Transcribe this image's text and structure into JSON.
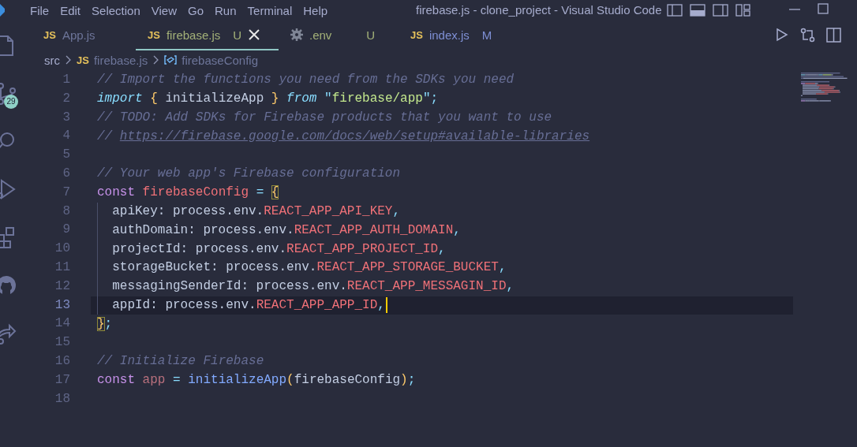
{
  "menu": [
    {
      "label": "File"
    },
    {
      "label": "Edit"
    },
    {
      "label": "Selection"
    },
    {
      "label": "View"
    },
    {
      "label": "Go"
    },
    {
      "label": "Run"
    },
    {
      "label": "Terminal"
    },
    {
      "label": "Help"
    }
  ],
  "window": {
    "title": "firebase.js - clone_project - Visual Studio Code"
  },
  "activity_bar": {
    "source_control_badge": "29"
  },
  "tabs": [
    {
      "kind": "js",
      "icon_text": "JS",
      "label": "App.js",
      "color": "#6d7599",
      "selected": false
    },
    {
      "kind": "js",
      "icon_text": "JS",
      "label": "firebase.js",
      "color": "#a3b178",
      "badge": "U",
      "selected": true
    },
    {
      "kind": "settings",
      "label": ".env",
      "color": "#a3b178",
      "badge": "U",
      "selected": false
    },
    {
      "kind": "js",
      "icon_text": "JS",
      "label": "index.js",
      "color": "#7e8fd4",
      "badge": "M",
      "selected": false
    }
  ],
  "breadcrumb": [
    {
      "kind": "folder",
      "label": "src"
    },
    {
      "kind": "js",
      "icon_text": "JS",
      "label": "firebase.js"
    },
    {
      "kind": "symbol",
      "label": "firebaseConfig"
    }
  ],
  "lines": [
    {
      "number": "1",
      "current": false,
      "cursor": false,
      "tokens": [
        {
          "kind": "comment",
          "text": "// Import the functions you need from the SDKs you need"
        }
      ]
    },
    {
      "number": "2",
      "current": false,
      "cursor": false,
      "tokens": [
        {
          "kind": "keyword",
          "text": "import"
        },
        {
          "kind": "brace",
          "text": " {"
        },
        {
          "kind": "plain",
          "text": " initializeApp "
        },
        {
          "kind": "brace",
          "text": "} "
        },
        {
          "kind": "keyword",
          "text": "from "
        },
        {
          "kind": "punct",
          "text": "\""
        },
        {
          "kind": "string",
          "text": "firebase/app"
        },
        {
          "kind": "punct",
          "text": "\";"
        }
      ]
    },
    {
      "number": "3",
      "current": false,
      "cursor": false,
      "tokens": [
        {
          "kind": "comment",
          "text": "// TODO: Add SDKs for Firebase products that you want to use"
        }
      ]
    },
    {
      "number": "4",
      "current": false,
      "cursor": false,
      "tokens": [
        {
          "kind": "comment",
          "text": "// "
        },
        {
          "kind": "link",
          "text": "https://firebase.google.com/docs/web/setup#available-libraries"
        }
      ]
    },
    {
      "number": "5",
      "current": false,
      "cursor": false
    },
    {
      "number": "6",
      "current": false,
      "cursor": false,
      "tokens": [
        {
          "kind": "comment",
          "text": "// Your web app's Firebase configuration"
        }
      ]
    },
    {
      "number": "7",
      "current": false,
      "cursor": false,
      "tokens": [
        {
          "kind": "storage",
          "text": "const "
        },
        {
          "kind": "definition",
          "text": "firebaseConfig"
        },
        {
          "kind": "punct",
          "text": " = "
        },
        {
          "kind": "bracket_match",
          "text": "{"
        }
      ]
    },
    {
      "number": "8",
      "current": false,
      "cursor": false,
      "indented": true,
      "tokens": [
        {
          "kind": "plain",
          "text": "apiKey: process.env."
        },
        {
          "kind": "env",
          "text": "REACT_APP_API_KEY"
        },
        {
          "kind": "punct",
          "text": ","
        }
      ]
    },
    {
      "number": "9",
      "current": false,
      "cursor": false,
      "indented": true,
      "tokens": [
        {
          "kind": "plain",
          "text": "authDomain: process.env."
        },
        {
          "kind": "env",
          "text": "REACT_APP_AUTH_DOMAIN"
        },
        {
          "kind": "punct",
          "text": ","
        }
      ]
    },
    {
      "number": "10",
      "current": false,
      "cursor": false,
      "indented": true,
      "tokens": [
        {
          "kind": "plain",
          "text": "projectId: process.env."
        },
        {
          "kind": "env",
          "text": "REACT_APP_PROJECT_ID"
        },
        {
          "kind": "punct",
          "text": ","
        }
      ]
    },
    {
      "number": "11",
      "current": false,
      "cursor": false,
      "indented": true,
      "tokens": [
        {
          "kind": "plain",
          "text": "storageBucket: process.env."
        },
        {
          "kind": "env",
          "text": "REACT_APP_STORAGE_BUCKET"
        },
        {
          "kind": "punct",
          "text": ","
        }
      ]
    },
    {
      "number": "12",
      "current": false,
      "cursor": false,
      "indented": true,
      "tokens": [
        {
          "kind": "plain",
          "text": "messagingSenderId: process.env."
        },
        {
          "kind": "env",
          "text": "REACT_APP_MESSAGIN_ID"
        },
        {
          "kind": "punct",
          "text": ","
        }
      ]
    },
    {
      "number": "13",
      "current": true,
      "cursor": true,
      "indented": true,
      "tokens": [
        {
          "kind": "plain",
          "text": "appId: process.env."
        },
        {
          "kind": "env",
          "text": "REACT_APP_APP_ID"
        },
        {
          "kind": "punct",
          "text": ","
        }
      ]
    },
    {
      "number": "14",
      "current": false,
      "cursor": false,
      "tokens": [
        {
          "kind": "bracket_match",
          "text": "}"
        },
        {
          "kind": "punct",
          "text": ";"
        }
      ]
    },
    {
      "number": "15",
      "current": false,
      "cursor": false
    },
    {
      "number": "16",
      "current": false,
      "cursor": false,
      "tokens": [
        {
          "kind": "comment",
          "text": "// Initialize Firebase"
        }
      ]
    },
    {
      "number": "17",
      "current": false,
      "cursor": false,
      "tokens": [
        {
          "kind": "storage",
          "text": "const "
        },
        {
          "kind": "variable",
          "text": "app"
        },
        {
          "kind": "punct",
          "text": " = "
        },
        {
          "kind": "function",
          "text": "initializeApp"
        },
        {
          "kind": "brace",
          "text": "("
        },
        {
          "kind": "plain",
          "text": "firebaseConfig"
        },
        {
          "kind": "brace",
          "text": ")"
        },
        {
          "kind": "punct",
          "text": ";"
        }
      ]
    },
    {
      "number": "18",
      "current": false,
      "cursor": false
    }
  ]
}
